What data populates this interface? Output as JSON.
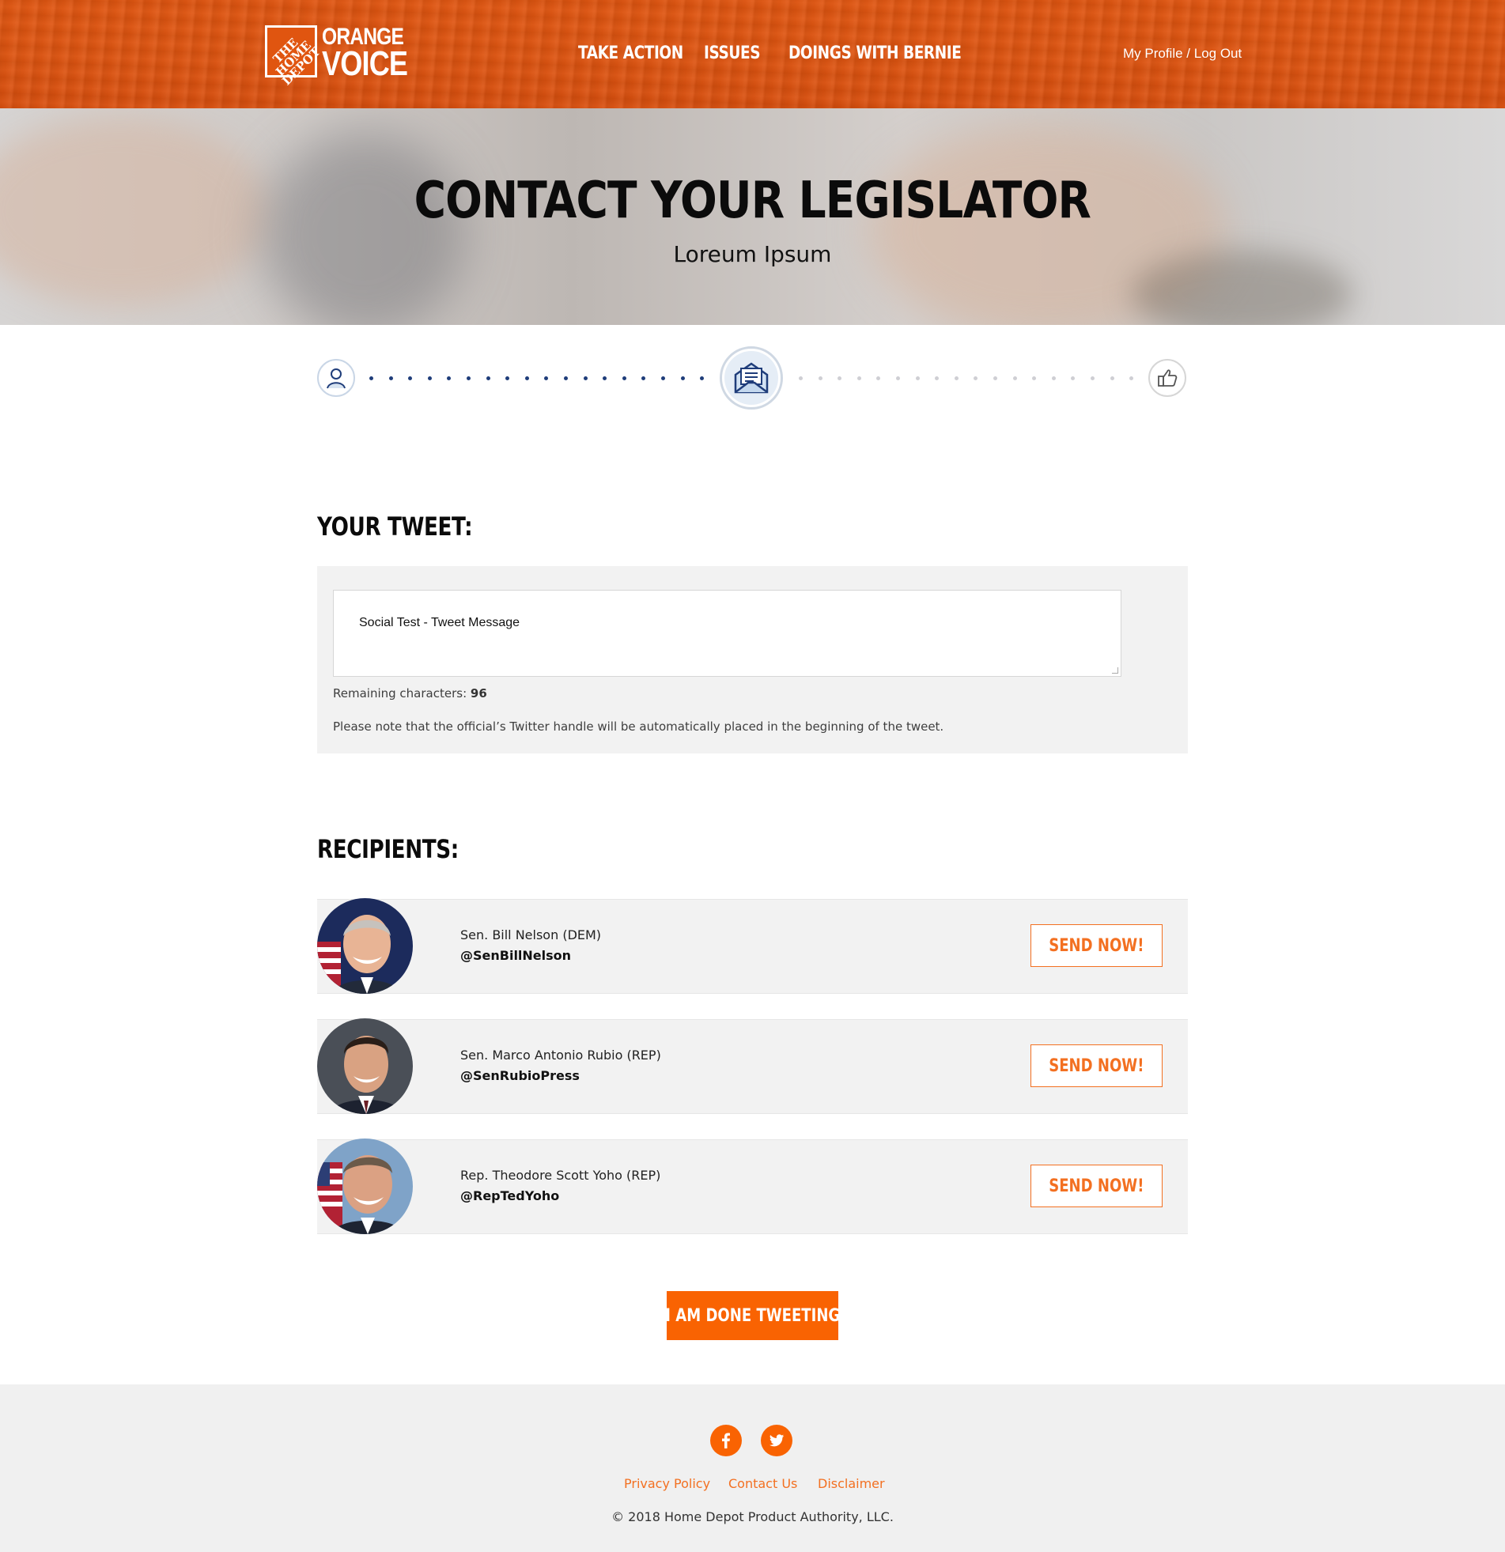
{
  "header": {
    "logo": {
      "box_text": "THE HOME DEPOT",
      "line1": "ORANGE",
      "line2": "VOICE"
    },
    "nav": [
      {
        "label": "TAKE ACTION"
      },
      {
        "label": "ISSUES"
      },
      {
        "label": "DOINGS WITH BERNIE"
      }
    ],
    "profile_link": "My Profile / Log Out"
  },
  "hero": {
    "title": "CONTACT YOUR LEGISLATOR",
    "subtitle": "Loreum Ipsum"
  },
  "stepper": {
    "steps": [
      {
        "icon": "user-icon"
      },
      {
        "icon": "envelope-icon"
      },
      {
        "icon": "thumbs-up-icon"
      }
    ],
    "active_step": 2,
    "total_steps": 3
  },
  "tweet": {
    "heading": "YOUR TWEET:",
    "message": "Social Test - Tweet Message",
    "remaining_label": "Remaining characters:",
    "remaining_value": "96",
    "note": "Please note that the official’s Twitter handle will be automatically placed in the beginning of the tweet."
  },
  "recipients": {
    "heading": "RECIPIENTS:",
    "items": [
      {
        "name": "Sen. Bill Nelson (DEM)",
        "handle": "@SenBillNelson",
        "button": "SEND NOW!"
      },
      {
        "name": "Sen. Marco Antonio Rubio (REP)",
        "handle": "@SenRubioPress",
        "button": "SEND NOW!"
      },
      {
        "name": "Rep. Theodore Scott Yoho (REP)",
        "handle": "@RepTedYoho",
        "button": "SEND NOW!"
      }
    ]
  },
  "done_button": "I AM DONE TWEETING",
  "footer": {
    "social": [
      {
        "icon": "facebook-icon"
      },
      {
        "icon": "twitter-icon"
      }
    ],
    "links": [
      "Privacy Policy",
      "Contact Us",
      "Disclaimer"
    ],
    "copyright": "© 2018 Home Depot Product Authority, LLC."
  },
  "colors": {
    "brand_orange": "#f96302",
    "header_orange": "#e05510",
    "link_orange": "#f37021",
    "stepper_blue": "#1f3d7a",
    "panel_gray": "#f2f2f2",
    "footer_gray": "#f0f0f0"
  }
}
